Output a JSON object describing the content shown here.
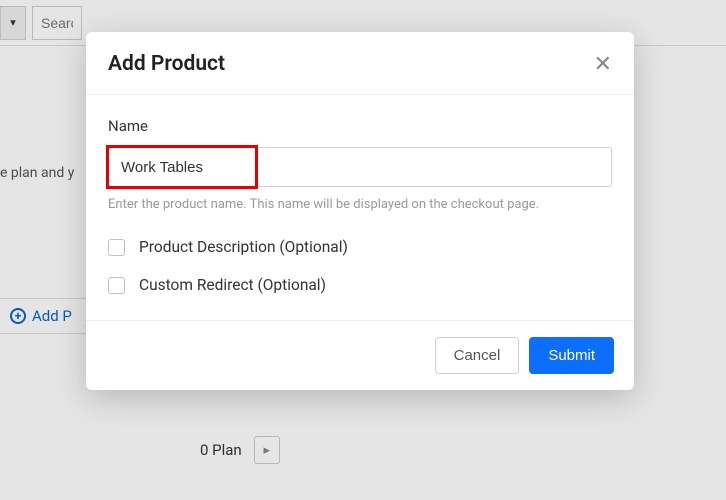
{
  "background": {
    "filter_caret": "▾",
    "search_placeholder": "Searc",
    "strip_text": "e plan and y",
    "add_plan_label": "Add P",
    "plan_count": "0 Plan"
  },
  "modal": {
    "title": "Add Product",
    "name_label": "Name",
    "name_value": "Work Tables",
    "name_helper": "Enter the product name. This name will be displayed on the checkout page.",
    "description_label": "Product Description (Optional)",
    "redirect_label": "Custom Redirect (Optional)",
    "cancel_label": "Cancel",
    "submit_label": "Submit"
  }
}
